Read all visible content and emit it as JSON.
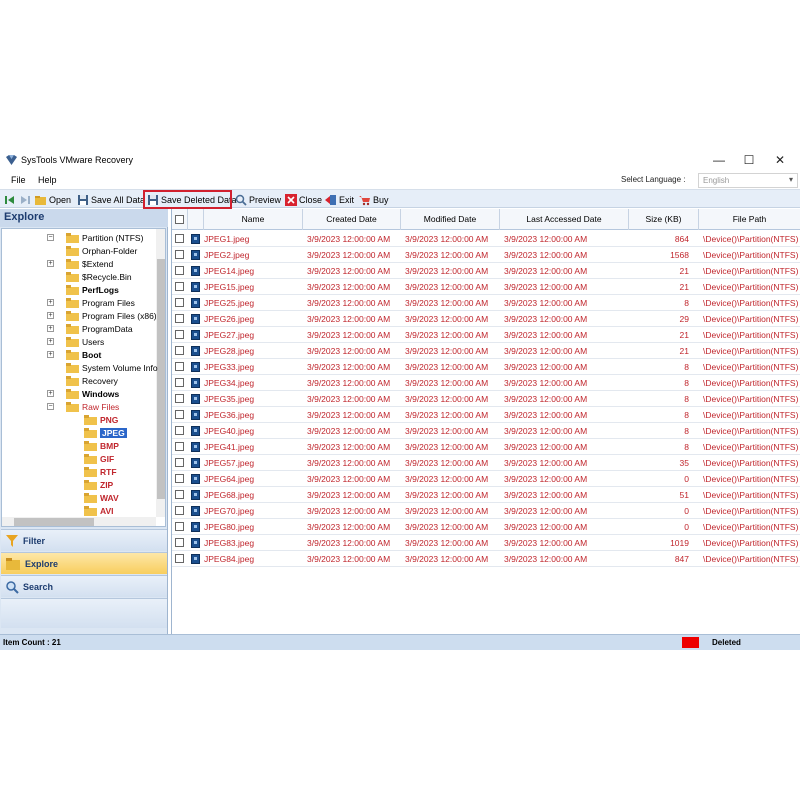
{
  "window": {
    "title": "SysTools VMware Recovery",
    "controls": {
      "minimize": "—",
      "maximize": "☐",
      "close": "✕"
    }
  },
  "menu": {
    "items": [
      "File",
      "Help"
    ],
    "language_label": "Select Language :",
    "language_value": "English"
  },
  "toolbar": {
    "open": "Open",
    "save_all": "Save All Data",
    "save_deleted": "Save Deleted Data",
    "preview": "Preview",
    "close": "Close",
    "exit": "Exit",
    "buy": "Buy"
  },
  "left_panel": {
    "header": "Explore",
    "tree": [
      {
        "label": "Partition (NTFS)",
        "bold": false,
        "red": false,
        "expander": "minus"
      },
      {
        "label": "Orphan-Folder",
        "bold": false,
        "red": false,
        "expander": ""
      },
      {
        "label": "$Extend",
        "bold": false,
        "red": false,
        "expander": "plus"
      },
      {
        "label": "$Recycle.Bin",
        "bold": false,
        "red": false,
        "expander": ""
      },
      {
        "label": "PerfLogs",
        "bold": true,
        "red": false,
        "expander": ""
      },
      {
        "label": "Program Files",
        "bold": false,
        "red": false,
        "expander": "plus"
      },
      {
        "label": "Program Files (x86)",
        "bold": false,
        "red": false,
        "expander": "plus"
      },
      {
        "label": "ProgramData",
        "bold": false,
        "red": false,
        "expander": "plus"
      },
      {
        "label": "Users",
        "bold": false,
        "red": false,
        "expander": "plus"
      },
      {
        "label": "Boot",
        "bold": true,
        "red": false,
        "expander": "plus"
      },
      {
        "label": "System Volume Info",
        "bold": false,
        "red": false,
        "expander": ""
      },
      {
        "label": "Recovery",
        "bold": false,
        "red": false,
        "expander": ""
      },
      {
        "label": "Windows",
        "bold": true,
        "red": false,
        "expander": "plus"
      },
      {
        "label": "Raw Files",
        "bold": false,
        "red": true,
        "expander": "minus"
      },
      {
        "label": "PNG",
        "bold": true,
        "red": true,
        "expander": ""
      },
      {
        "label": "JPEG",
        "bold": true,
        "red": false,
        "expander": "",
        "selected": true
      },
      {
        "label": "BMP",
        "bold": true,
        "red": true,
        "expander": ""
      },
      {
        "label": "GIF",
        "bold": true,
        "red": true,
        "expander": ""
      },
      {
        "label": "RTF",
        "bold": true,
        "red": true,
        "expander": ""
      },
      {
        "label": "ZIP",
        "bold": true,
        "red": true,
        "expander": ""
      },
      {
        "label": "WAV",
        "bold": true,
        "red": true,
        "expander": ""
      },
      {
        "label": "AVI",
        "bold": true,
        "red": true,
        "expander": ""
      }
    ],
    "nav": [
      {
        "label": "Filter",
        "active": false
      },
      {
        "label": "Explore",
        "active": true
      },
      {
        "label": "Search",
        "active": false
      }
    ]
  },
  "grid": {
    "columns": [
      "Name",
      "Created Date",
      "Modified Date",
      "Last Accessed Date",
      "Size (KB)",
      "File Path"
    ],
    "rows": [
      {
        "name": "JPEG1.jpeg",
        "created": "3/9/2023 12:00:00 AM",
        "modified": "3/9/2023 12:00:00 AM",
        "accessed": "3/9/2023 12:00:00 AM",
        "size": "864",
        "path": "\\Device()\\Partition(NTFS)"
      },
      {
        "name": "JPEG2.jpeg",
        "created": "3/9/2023 12:00:00 AM",
        "modified": "3/9/2023 12:00:00 AM",
        "accessed": "3/9/2023 12:00:00 AM",
        "size": "1568",
        "path": "\\Device()\\Partition(NTFS)"
      },
      {
        "name": "JPEG14.jpeg",
        "created": "3/9/2023 12:00:00 AM",
        "modified": "3/9/2023 12:00:00 AM",
        "accessed": "3/9/2023 12:00:00 AM",
        "size": "21",
        "path": "\\Device()\\Partition(NTFS)"
      },
      {
        "name": "JPEG15.jpeg",
        "created": "3/9/2023 12:00:00 AM",
        "modified": "3/9/2023 12:00:00 AM",
        "accessed": "3/9/2023 12:00:00 AM",
        "size": "21",
        "path": "\\Device()\\Partition(NTFS)"
      },
      {
        "name": "JPEG25.jpeg",
        "created": "3/9/2023 12:00:00 AM",
        "modified": "3/9/2023 12:00:00 AM",
        "accessed": "3/9/2023 12:00:00 AM",
        "size": "8",
        "path": "\\Device()\\Partition(NTFS)"
      },
      {
        "name": "JPEG26.jpeg",
        "created": "3/9/2023 12:00:00 AM",
        "modified": "3/9/2023 12:00:00 AM",
        "accessed": "3/9/2023 12:00:00 AM",
        "size": "29",
        "path": "\\Device()\\Partition(NTFS)"
      },
      {
        "name": "JPEG27.jpeg",
        "created": "3/9/2023 12:00:00 AM",
        "modified": "3/9/2023 12:00:00 AM",
        "accessed": "3/9/2023 12:00:00 AM",
        "size": "21",
        "path": "\\Device()\\Partition(NTFS)"
      },
      {
        "name": "JPEG28.jpeg",
        "created": "3/9/2023 12:00:00 AM",
        "modified": "3/9/2023 12:00:00 AM",
        "accessed": "3/9/2023 12:00:00 AM",
        "size": "21",
        "path": "\\Device()\\Partition(NTFS)"
      },
      {
        "name": "JPEG33.jpeg",
        "created": "3/9/2023 12:00:00 AM",
        "modified": "3/9/2023 12:00:00 AM",
        "accessed": "3/9/2023 12:00:00 AM",
        "size": "8",
        "path": "\\Device()\\Partition(NTFS)"
      },
      {
        "name": "JPEG34.jpeg",
        "created": "3/9/2023 12:00:00 AM",
        "modified": "3/9/2023 12:00:00 AM",
        "accessed": "3/9/2023 12:00:00 AM",
        "size": "8",
        "path": "\\Device()\\Partition(NTFS)"
      },
      {
        "name": "JPEG35.jpeg",
        "created": "3/9/2023 12:00:00 AM",
        "modified": "3/9/2023 12:00:00 AM",
        "accessed": "3/9/2023 12:00:00 AM",
        "size": "8",
        "path": "\\Device()\\Partition(NTFS)"
      },
      {
        "name": "JPEG36.jpeg",
        "created": "3/9/2023 12:00:00 AM",
        "modified": "3/9/2023 12:00:00 AM",
        "accessed": "3/9/2023 12:00:00 AM",
        "size": "8",
        "path": "\\Device()\\Partition(NTFS)"
      },
      {
        "name": "JPEG40.jpeg",
        "created": "3/9/2023 12:00:00 AM",
        "modified": "3/9/2023 12:00:00 AM",
        "accessed": "3/9/2023 12:00:00 AM",
        "size": "8",
        "path": "\\Device()\\Partition(NTFS)"
      },
      {
        "name": "JPEG41.jpeg",
        "created": "3/9/2023 12:00:00 AM",
        "modified": "3/9/2023 12:00:00 AM",
        "accessed": "3/9/2023 12:00:00 AM",
        "size": "8",
        "path": "\\Device()\\Partition(NTFS)"
      },
      {
        "name": "JPEG57.jpeg",
        "created": "3/9/2023 12:00:00 AM",
        "modified": "3/9/2023 12:00:00 AM",
        "accessed": "3/9/2023 12:00:00 AM",
        "size": "35",
        "path": "\\Device()\\Partition(NTFS)"
      },
      {
        "name": "JPEG64.jpeg",
        "created": "3/9/2023 12:00:00 AM",
        "modified": "3/9/2023 12:00:00 AM",
        "accessed": "3/9/2023 12:00:00 AM",
        "size": "0",
        "path": "\\Device()\\Partition(NTFS)"
      },
      {
        "name": "JPEG68.jpeg",
        "created": "3/9/2023 12:00:00 AM",
        "modified": "3/9/2023 12:00:00 AM",
        "accessed": "3/9/2023 12:00:00 AM",
        "size": "51",
        "path": "\\Device()\\Partition(NTFS)"
      },
      {
        "name": "JPEG70.jpeg",
        "created": "3/9/2023 12:00:00 AM",
        "modified": "3/9/2023 12:00:00 AM",
        "accessed": "3/9/2023 12:00:00 AM",
        "size": "0",
        "path": "\\Device()\\Partition(NTFS)"
      },
      {
        "name": "JPEG80.jpeg",
        "created": "3/9/2023 12:00:00 AM",
        "modified": "3/9/2023 12:00:00 AM",
        "accessed": "3/9/2023 12:00:00 AM",
        "size": "0",
        "path": "\\Device()\\Partition(NTFS)"
      },
      {
        "name": "JPEG83.jpeg",
        "created": "3/9/2023 12:00:00 AM",
        "modified": "3/9/2023 12:00:00 AM",
        "accessed": "3/9/2023 12:00:00 AM",
        "size": "1019",
        "path": "\\Device()\\Partition(NTFS)"
      },
      {
        "name": "JPEG84.jpeg",
        "created": "3/9/2023 12:00:00 AM",
        "modified": "3/9/2023 12:00:00 AM",
        "accessed": "3/9/2023 12:00:00 AM",
        "size": "847",
        "path": "\\Device()\\Partition(NTFS)"
      }
    ]
  },
  "status": {
    "item_count": "Item Count : 21",
    "legend_label": "Deleted",
    "legend_color": "#ee0000"
  },
  "colors": {
    "deleted_text": "#c0262d",
    "highlight": "#d1202e",
    "selected_tree": "#2b66c9"
  }
}
